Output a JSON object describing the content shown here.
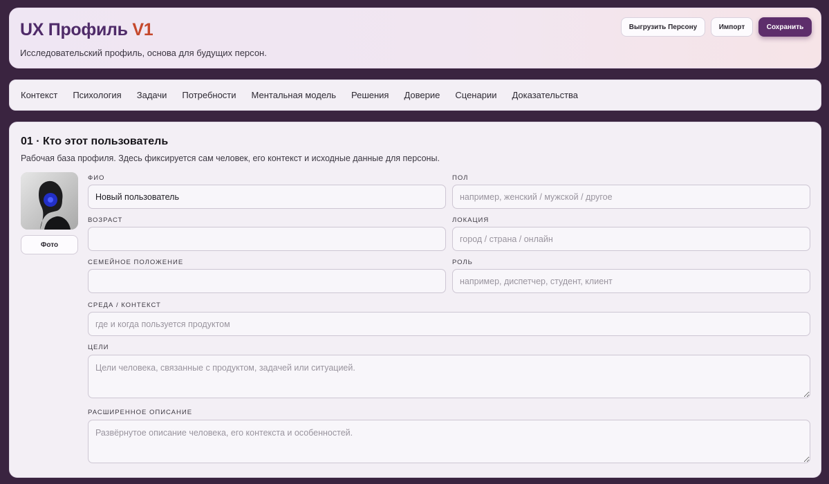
{
  "header": {
    "title_main": "UX Профиль",
    "title_version": "V1",
    "subtitle": "Исследовательский профиль, основа для будущих персон.",
    "buttons": {
      "export": "Выгрузить Персону",
      "import": "Импорт",
      "save": "Сохранить"
    }
  },
  "nav": {
    "items": [
      "Контекст",
      "Психология",
      "Задачи",
      "Потребности",
      "Ментальная модель",
      "Решения",
      "Доверие",
      "Сценарии",
      "Доказательства"
    ]
  },
  "section": {
    "title": "01 · Кто этот пользователь",
    "description": "Рабочая база профиля. Здесь фиксируется сам человек, его контекст и исходные данные для персоны.",
    "photo_button": "Фото",
    "fields": {
      "name": {
        "label": "ФИО",
        "value": "Новый пользователь",
        "placeholder": ""
      },
      "gender": {
        "label": "ПОЛ",
        "value": "",
        "placeholder": "например, женский / мужской / другое"
      },
      "age": {
        "label": "ВОЗРАСТ",
        "value": "",
        "placeholder": ""
      },
      "location": {
        "label": "ЛОКАЦИЯ",
        "value": "",
        "placeholder": "город / страна / онлайн"
      },
      "family": {
        "label": "СЕМЕЙНОЕ ПОЛОЖЕНИЕ",
        "value": "",
        "placeholder": ""
      },
      "role": {
        "label": "РОЛЬ",
        "value": "",
        "placeholder": "например, диспетчер, студент, клиент"
      },
      "environment": {
        "label": "СРЕДА / КОНТЕКСТ",
        "value": "",
        "placeholder": "где и когда пользуется продуктом"
      },
      "goals": {
        "label": "ЦЕЛИ",
        "value": "",
        "placeholder": "Цели человека, связанные с продуктом, задачей или ситуацией."
      },
      "extended": {
        "label": "РАСШИРЕННОЕ ОПИСАНИЕ",
        "value": "",
        "placeholder": "Развёрнутое описание человека, его контекста и особенностей."
      }
    }
  },
  "colors": {
    "background": "#3a2440",
    "accent": "#5d2e6b",
    "version": "#c5482c",
    "title": "#4f2b69"
  }
}
